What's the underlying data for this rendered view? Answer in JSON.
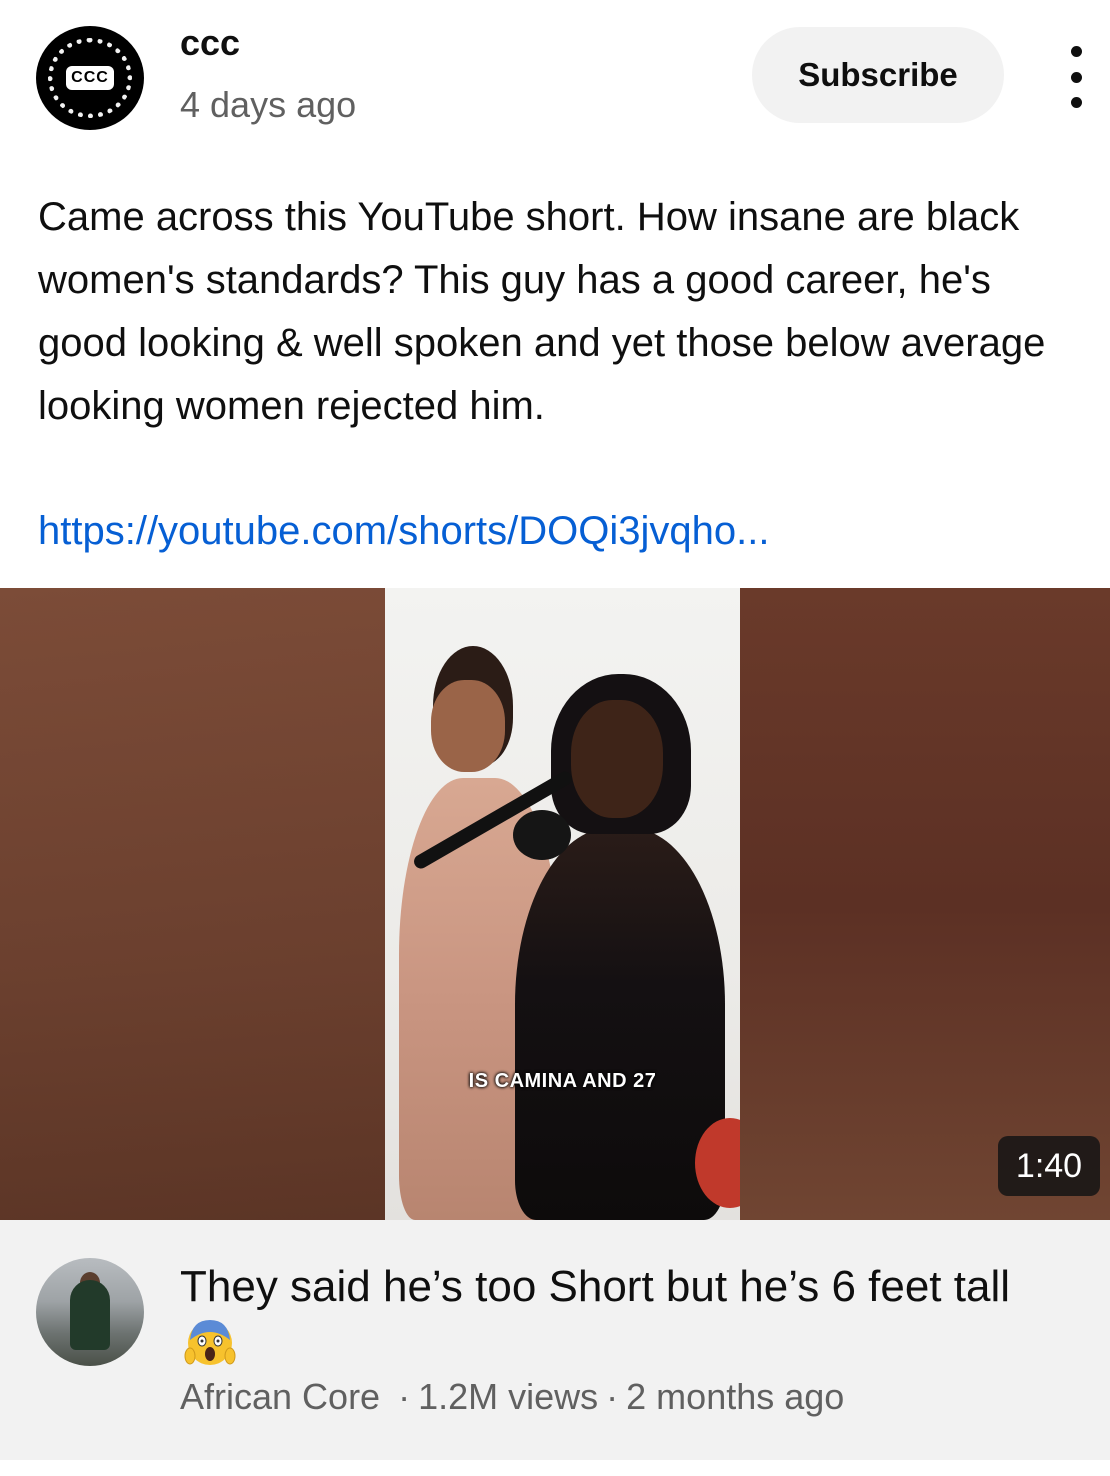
{
  "post": {
    "channel_name": "ccc",
    "avatar_text": "CCC",
    "time": "4 days ago",
    "subscribe_label": "Subscribe",
    "body": "Came across this YouTube short. How insane are black women's standards? This guy has a good career, he's good looking & well spoken and yet those below average looking women rejected him.",
    "link": "https://youtube.com/shorts/DOQi3jvqho..."
  },
  "video": {
    "caption": "IS CAMINA AND 27",
    "duration": "1:40",
    "title": "They said he’s too Short but he’s 6 feet tall",
    "emoji_icon": "face-screaming-in-fear",
    "channel": "African Core",
    "views": "1.2M views",
    "age": "2 months ago",
    "separator": "·"
  }
}
